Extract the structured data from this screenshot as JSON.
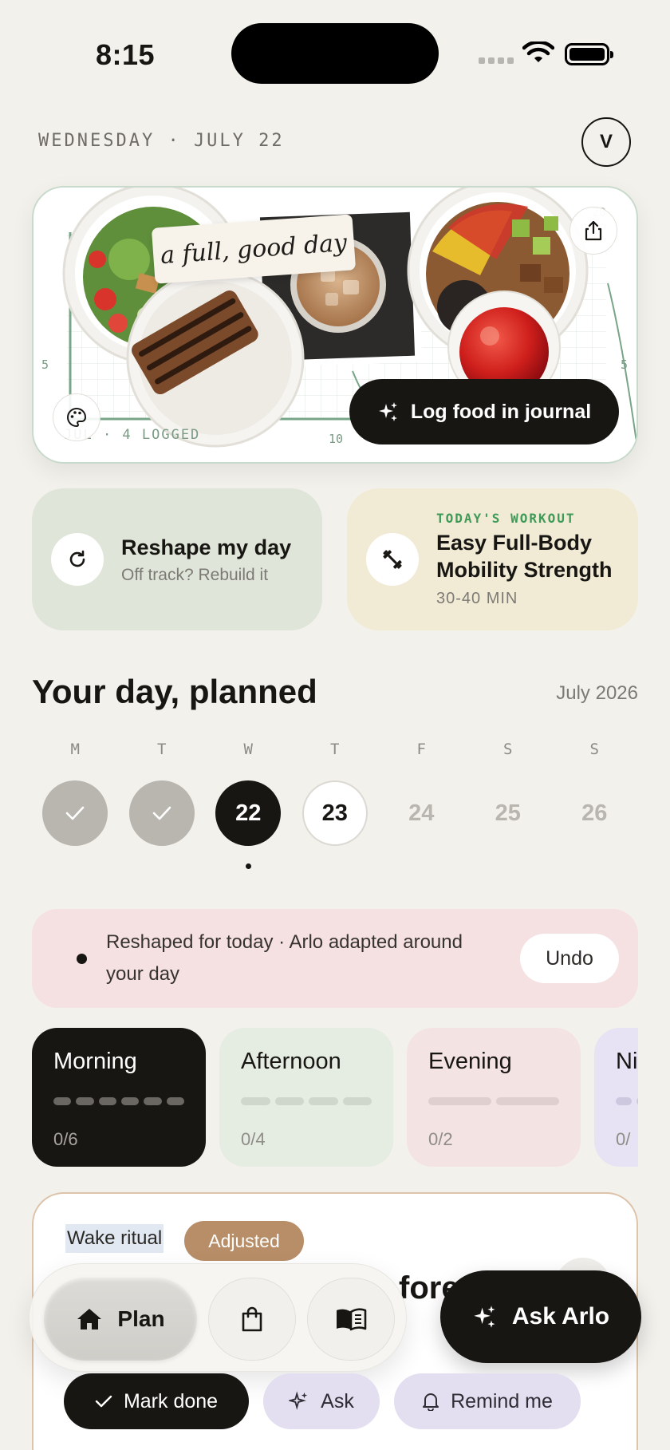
{
  "status_bar": {
    "time": "8:15"
  },
  "header": {
    "date": "WEDNESDAY · JULY 22",
    "avatar_initial": "V"
  },
  "hero": {
    "caption": "a full, good day",
    "logged_text": "JUL · 4 LOGGED",
    "log_button_label": "Log food in journal",
    "axis_labels": {
      "left": "5",
      "right": "5",
      "bottom": "10",
      "top_right": "20"
    }
  },
  "quick_cards": {
    "reshape": {
      "title": "Reshape my day",
      "subtitle": "Off track? Rebuild it"
    },
    "workout": {
      "eyebrow": "TODAY'S WORKOUT",
      "title_line1": "Easy Full-Body",
      "title_line2": "Mobility Strength",
      "duration": "30-40 MIN"
    }
  },
  "planner": {
    "title": "Your day, planned",
    "month": "July 2026",
    "days": [
      {
        "letter": "M",
        "label": "",
        "state": "done"
      },
      {
        "letter": "T",
        "label": "",
        "state": "done"
      },
      {
        "letter": "W",
        "label": "22",
        "state": "today"
      },
      {
        "letter": "T",
        "label": "23",
        "state": "next"
      },
      {
        "letter": "F",
        "label": "24",
        "state": "future"
      },
      {
        "letter": "S",
        "label": "25",
        "state": "future"
      },
      {
        "letter": "S",
        "label": "26",
        "state": "future"
      }
    ]
  },
  "banner": {
    "text": "Reshaped for today · Arlo adapted around your day",
    "undo_label": "Undo"
  },
  "slots": [
    {
      "name": "Morning",
      "count": "0/6"
    },
    {
      "name": "Afternoon",
      "count": "0/4"
    },
    {
      "name": "Evening",
      "count": "0/2"
    },
    {
      "name": "Ni",
      "count": "0/"
    }
  ],
  "task": {
    "tag": "Wake ritual",
    "badge": "Adjusted",
    "title_fragment": "fore"
  },
  "nav": {
    "plan_label": "Plan"
  },
  "ask_button_label": "Ask Arlo",
  "task_actions": {
    "done_label": "Mark done",
    "ask_label": "Ask",
    "remind_label": "Remind me"
  },
  "colors": {
    "accent_dark": "#181613",
    "sage": "#dfe5d8",
    "cream": "#f1ebd6",
    "blush": "#f6e1e2",
    "badge_tan": "#b88e68",
    "workout_green": "#3f9a58"
  }
}
